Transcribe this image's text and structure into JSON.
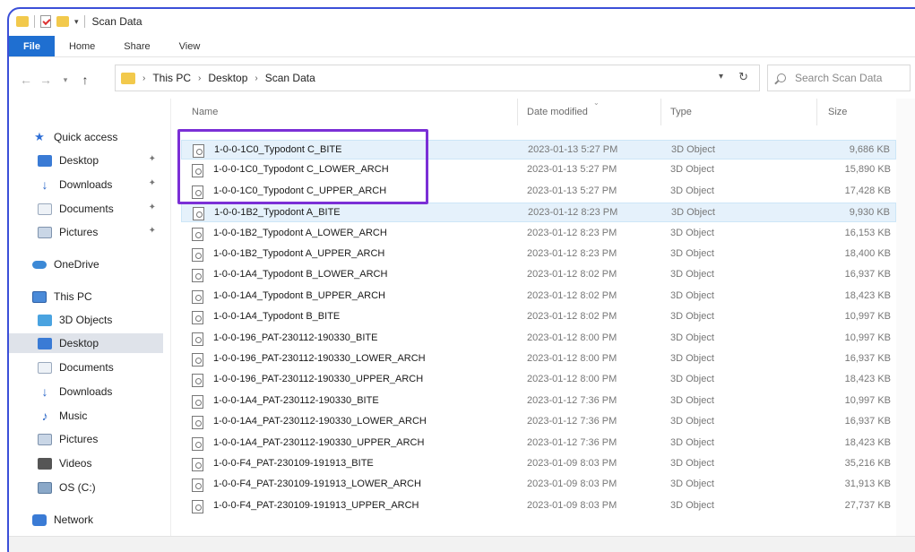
{
  "window": {
    "title": "Scan Data"
  },
  "ribbon": {
    "tabs": [
      "File",
      "Home",
      "Share",
      "View"
    ]
  },
  "address": {
    "crumbs": [
      "This PC",
      "Desktop",
      "Scan Data"
    ]
  },
  "search": {
    "placeholder": "Search Scan Data"
  },
  "sidebar": {
    "items": [
      {
        "label": "Quick access",
        "icon": "star-icon"
      },
      {
        "label": "Desktop",
        "icon": "desktop-icon",
        "pinned": true
      },
      {
        "label": "Downloads",
        "icon": "download-icon",
        "pinned": true
      },
      {
        "label": "Documents",
        "icon": "documents-icon",
        "pinned": true
      },
      {
        "label": "Pictures",
        "icon": "pictures-icon",
        "pinned": true
      },
      {
        "label": "OneDrive",
        "icon": "cloud-icon"
      },
      {
        "label": "This PC",
        "icon": "computer-icon"
      },
      {
        "label": "3D Objects",
        "icon": "3d-objects-icon"
      },
      {
        "label": "Desktop",
        "icon": "desktop-icon",
        "selected": true
      },
      {
        "label": "Documents",
        "icon": "documents-icon"
      },
      {
        "label": "Downloads",
        "icon": "download-icon"
      },
      {
        "label": "Music",
        "icon": "music-icon"
      },
      {
        "label": "Pictures",
        "icon": "pictures-icon"
      },
      {
        "label": "Videos",
        "icon": "videos-icon"
      },
      {
        "label": "OS (C:)",
        "icon": "drive-icon"
      },
      {
        "label": "Network",
        "icon": "network-icon"
      }
    ]
  },
  "columns": {
    "name": "Name",
    "date": "Date modified",
    "type": "Type",
    "size": "Size"
  },
  "files": [
    {
      "name": "1-0-0-1C0_Typodont C_BITE",
      "date": "2023-01-13 5:27 PM",
      "type": "3D Object",
      "size": "9,686 KB",
      "selected": true
    },
    {
      "name": "1-0-0-1C0_Typodont C_LOWER_ARCH",
      "date": "2023-01-13 5:27 PM",
      "type": "3D Object",
      "size": "15,890 KB"
    },
    {
      "name": "1-0-0-1C0_Typodont C_UPPER_ARCH",
      "date": "2023-01-13 5:27 PM",
      "type": "3D Object",
      "size": "17,428 KB"
    },
    {
      "name": "1-0-0-1B2_Typodont A_BITE",
      "date": "2023-01-12 8:23 PM",
      "type": "3D Object",
      "size": "9,930 KB",
      "selected": true
    },
    {
      "name": "1-0-0-1B2_Typodont A_LOWER_ARCH",
      "date": "2023-01-12 8:23 PM",
      "type": "3D Object",
      "size": "16,153 KB"
    },
    {
      "name": "1-0-0-1B2_Typodont A_UPPER_ARCH",
      "date": "2023-01-12 8:23 PM",
      "type": "3D Object",
      "size": "18,400 KB"
    },
    {
      "name": "1-0-0-1A4_Typodont B_LOWER_ARCH",
      "date": "2023-01-12 8:02 PM",
      "type": "3D Object",
      "size": "16,937 KB"
    },
    {
      "name": "1-0-0-1A4_Typodont B_UPPER_ARCH",
      "date": "2023-01-12 8:02 PM",
      "type": "3D Object",
      "size": "18,423 KB"
    },
    {
      "name": "1-0-0-1A4_Typodont B_BITE",
      "date": "2023-01-12 8:02 PM",
      "type": "3D Object",
      "size": "10,997 KB"
    },
    {
      "name": "1-0-0-196_PAT-230112-190330_BITE",
      "date": "2023-01-12 8:00 PM",
      "type": "3D Object",
      "size": "10,997 KB"
    },
    {
      "name": "1-0-0-196_PAT-230112-190330_LOWER_ARCH",
      "date": "2023-01-12 8:00 PM",
      "type": "3D Object",
      "size": "16,937 KB"
    },
    {
      "name": "1-0-0-196_PAT-230112-190330_UPPER_ARCH",
      "date": "2023-01-12 8:00 PM",
      "type": "3D Object",
      "size": "18,423 KB"
    },
    {
      "name": "1-0-0-1A4_PAT-230112-190330_BITE",
      "date": "2023-01-12 7:36 PM",
      "type": "3D Object",
      "size": "10,997 KB"
    },
    {
      "name": "1-0-0-1A4_PAT-230112-190330_LOWER_ARCH",
      "date": "2023-01-12 7:36 PM",
      "type": "3D Object",
      "size": "16,937 KB"
    },
    {
      "name": "1-0-0-1A4_PAT-230112-190330_UPPER_ARCH",
      "date": "2023-01-12 7:36 PM",
      "type": "3D Object",
      "size": "18,423 KB"
    },
    {
      "name": "1-0-0-F4_PAT-230109-191913_BITE",
      "date": "2023-01-09 8:03 PM",
      "type": "3D Object",
      "size": "35,216 KB"
    },
    {
      "name": "1-0-0-F4_PAT-230109-191913_LOWER_ARCH",
      "date": "2023-01-09 8:03 PM",
      "type": "3D Object",
      "size": "31,913 KB"
    },
    {
      "name": "1-0-0-F4_PAT-230109-191913_UPPER_ARCH",
      "date": "2023-01-09 8:03 PM",
      "type": "3D Object",
      "size": "27,737 KB"
    }
  ]
}
